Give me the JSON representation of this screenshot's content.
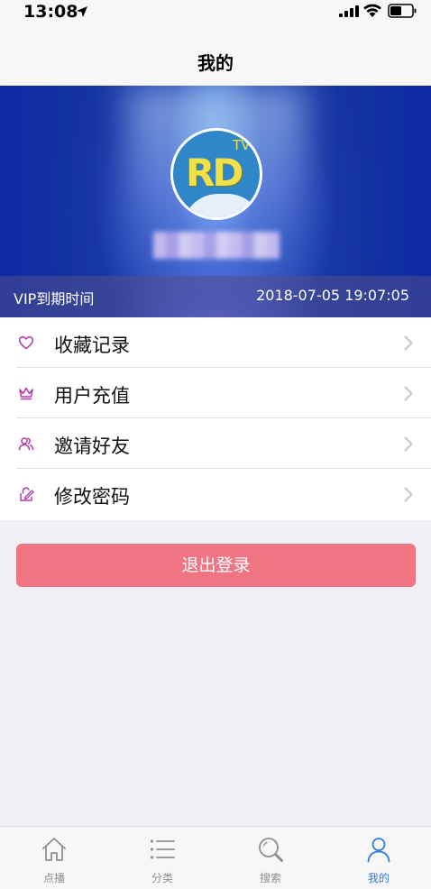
{
  "status_bar": {
    "time": "13:08"
  },
  "nav": {
    "title": "我的"
  },
  "profile": {
    "avatar_text": "RD",
    "avatar_superscript": "TV",
    "vip_label": "VIP到期时间",
    "vip_expiry": "2018-07-05 19:07:05"
  },
  "menu": {
    "items": [
      {
        "label": "收藏记录",
        "icon": "heart-icon"
      },
      {
        "label": "用户充值",
        "icon": "crown-icon"
      },
      {
        "label": "邀请好友",
        "icon": "people-icon"
      },
      {
        "label": "修改密码",
        "icon": "edit-lock-icon"
      }
    ]
  },
  "logout": {
    "label": "退出登录"
  },
  "tabs": [
    {
      "label": "点播",
      "icon": "home-icon",
      "active": false
    },
    {
      "label": "分类",
      "icon": "list-icon",
      "active": false
    },
    {
      "label": "搜索",
      "icon": "search-icon",
      "active": false
    },
    {
      "label": "我的",
      "icon": "person-icon",
      "active": true
    }
  ],
  "colors": {
    "accent": "#ef7583",
    "menu_icon": "#b03aa8",
    "tab_active": "#2b7be0",
    "banner": "#13339f"
  }
}
